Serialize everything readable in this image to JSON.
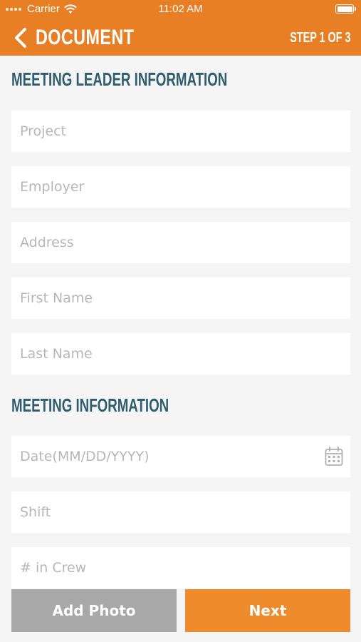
{
  "status_bar": {
    "carrier": "Carrier",
    "time": "11:02 AM"
  },
  "nav": {
    "title": "DOCUMENT",
    "step": "STEP 1 OF 3"
  },
  "sections": {
    "leader": {
      "title": "MEETING LEADER INFORMATION",
      "fields": {
        "project": "Project",
        "employer": "Employer",
        "address": "Address",
        "first_name": "First Name",
        "last_name": "Last Name"
      }
    },
    "meeting": {
      "title": "MEETING INFORMATION",
      "fields": {
        "date": "Date(MM/DD/YYYY)",
        "shift": "Shift",
        "crew": "# in Crew"
      }
    }
  },
  "buttons": {
    "add_photo": "Add Photo",
    "next": "Next"
  },
  "colors": {
    "accent": "#e87f24",
    "heading": "#2e5d6e",
    "secondary_button": "#a8a8a8"
  },
  "icons": {
    "back": "chevron-left-icon",
    "calendar": "calendar-icon",
    "wifi": "wifi-icon",
    "battery": "battery-icon"
  }
}
